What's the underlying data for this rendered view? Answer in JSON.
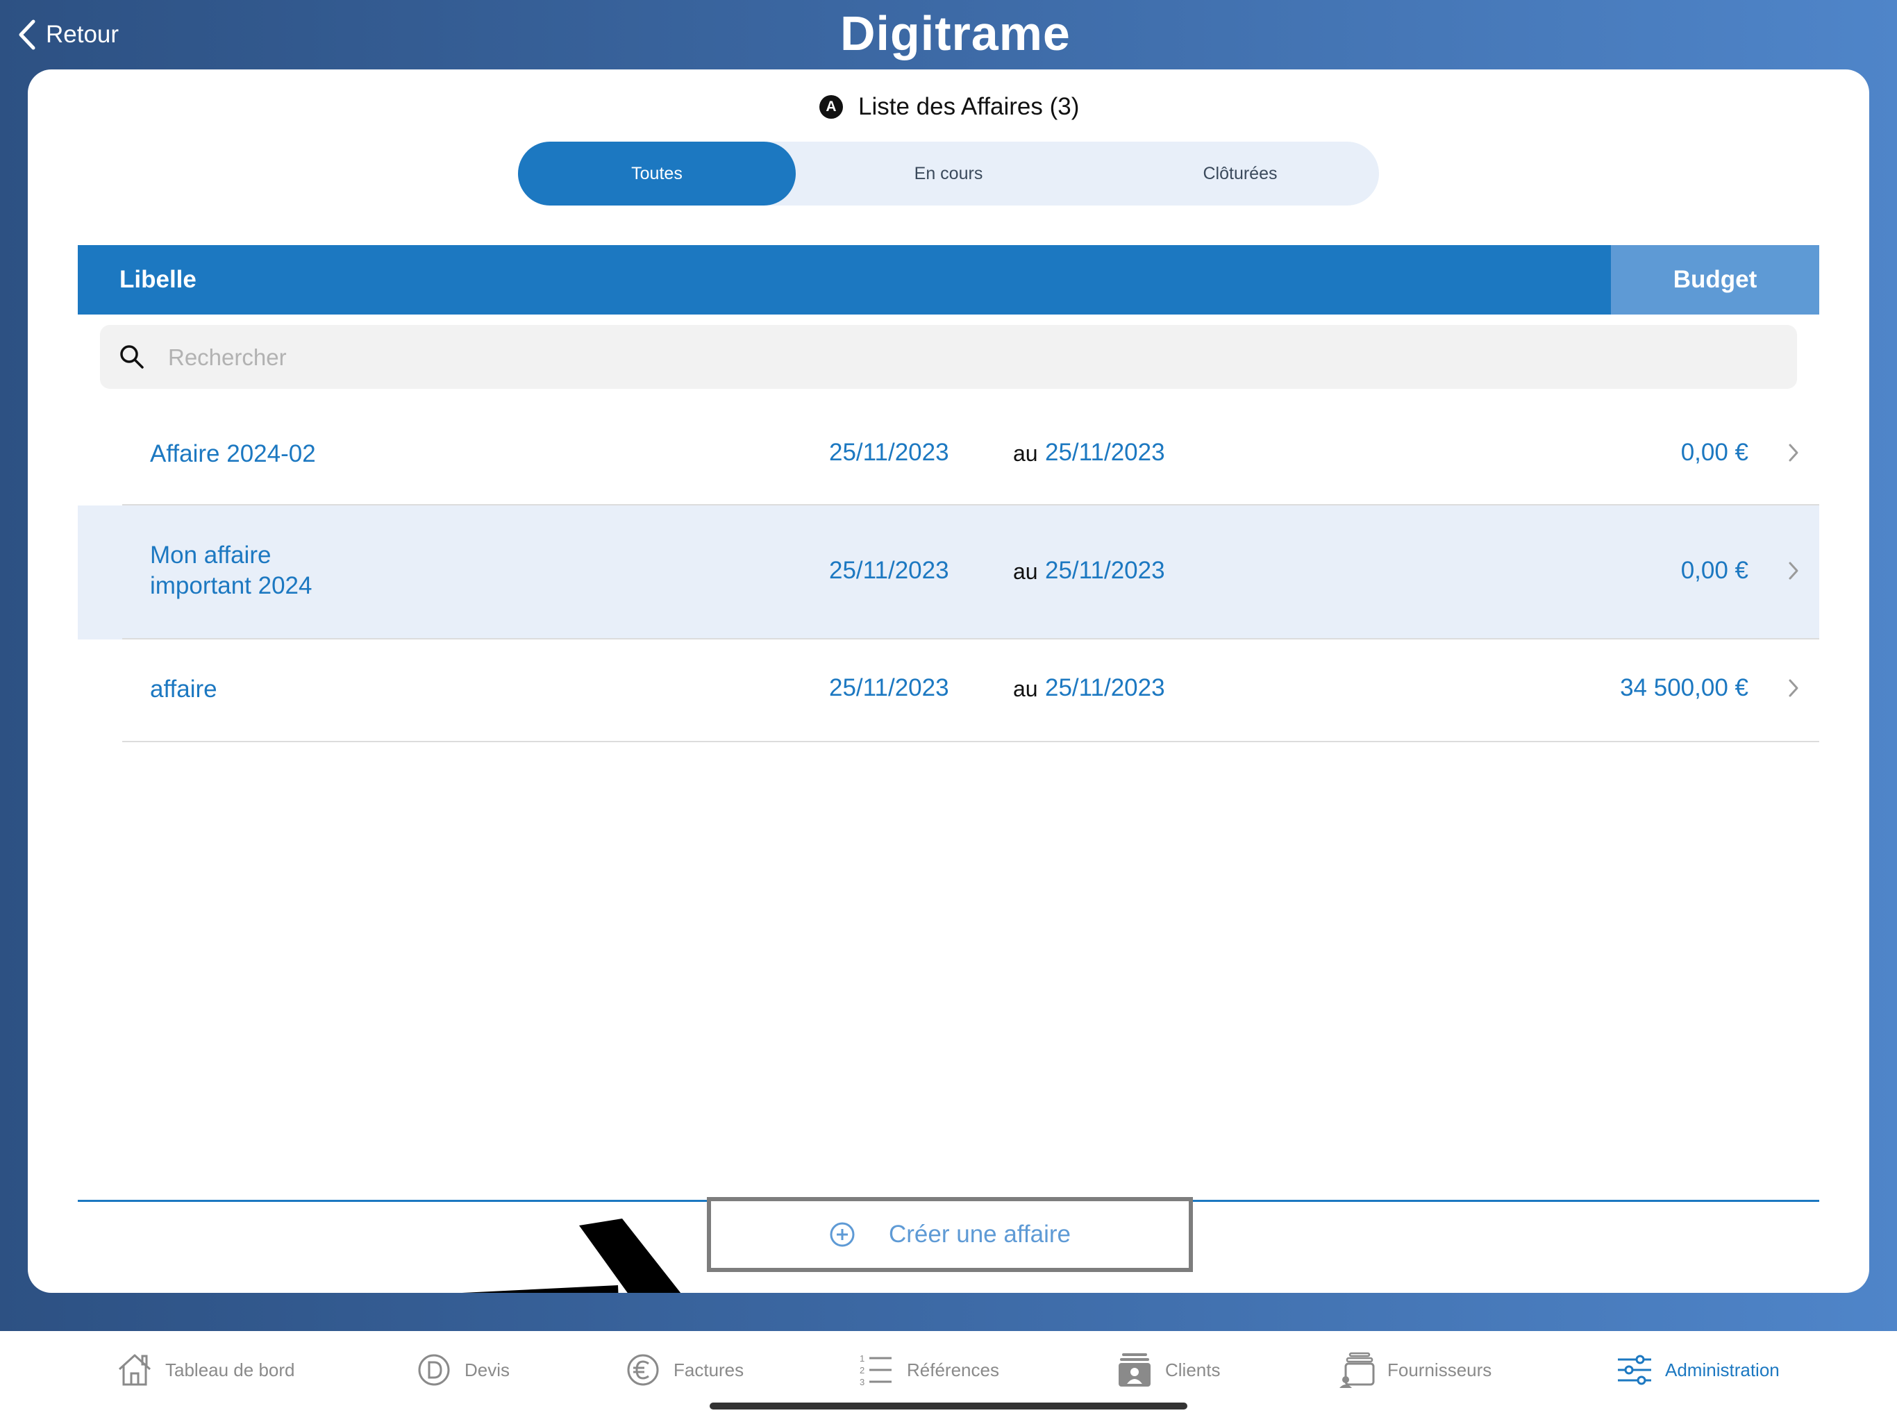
{
  "topbar": {
    "back_label": "Retour",
    "brand": "Digitrame"
  },
  "page": {
    "badge": "A",
    "title": "Liste des Affaires (3)"
  },
  "filter_tabs": [
    {
      "label": "Toutes",
      "active": true
    },
    {
      "label": "En cours",
      "active": false
    },
    {
      "label": "Clôturées",
      "active": false
    }
  ],
  "table": {
    "col_label": "Libelle",
    "col_budget": "Budget"
  },
  "search": {
    "placeholder": "Rechercher",
    "value": ""
  },
  "rows": [
    {
      "name_line1": "Affaire 2024-02",
      "name_line2": "",
      "start": "25/11/2023",
      "sep": "au",
      "end": "25/11/2023",
      "amount": "0,00 €"
    },
    {
      "name_line1": "Mon affaire",
      "name_line2": "important 2024",
      "start": "25/11/2023",
      "sep": "au",
      "end": "25/11/2023",
      "amount": "0,00 €"
    },
    {
      "name_line1": "affaire",
      "name_line2": "",
      "start": "25/11/2023",
      "sep": "au",
      "end": "25/11/2023",
      "amount": "34 500,00 €"
    }
  ],
  "footer": {
    "create_label": "Créer une affaire"
  },
  "tabbar": [
    {
      "label": "Tableau de bord",
      "icon": "house-icon",
      "active": false
    },
    {
      "label": "Devis",
      "icon": "devis-icon",
      "active": false
    },
    {
      "label": "Factures",
      "icon": "euro-icon",
      "active": false
    },
    {
      "label": "Références",
      "icon": "numbered-list-icon",
      "active": false
    },
    {
      "label": "Clients",
      "icon": "contact-card-icon",
      "active": false
    },
    {
      "label": "Fournisseurs",
      "icon": "supplier-icon",
      "active": false
    },
    {
      "label": "Administration",
      "icon": "sliders-icon",
      "active": true
    }
  ],
  "colors": {
    "accent": "#1c78c1",
    "accent_light": "#5e9ad5",
    "row_alt": "#e8eff9",
    "muted": "#8a8a8a"
  }
}
